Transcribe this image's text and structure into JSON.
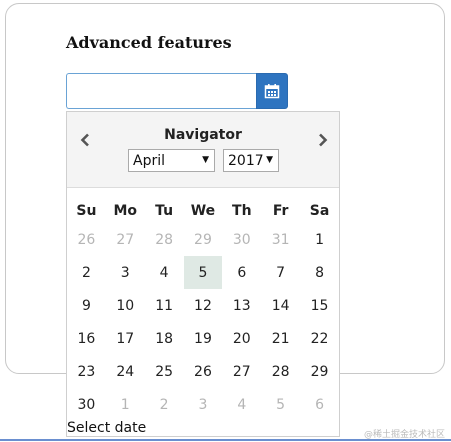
{
  "page": {
    "heading": "Advanced features"
  },
  "date_input": {
    "value": ""
  },
  "navigator": {
    "title": "Navigator",
    "month": "April",
    "year": "2017"
  },
  "calendar": {
    "weekdays": [
      "Su",
      "Mo",
      "Tu",
      "We",
      "Th",
      "Fr",
      "Sa"
    ],
    "weeks": [
      [
        {
          "d": "26",
          "m": true
        },
        {
          "d": "27",
          "m": true
        },
        {
          "d": "28",
          "m": true
        },
        {
          "d": "29",
          "m": true
        },
        {
          "d": "30",
          "m": true
        },
        {
          "d": "31",
          "m": true
        },
        {
          "d": "1"
        }
      ],
      [
        {
          "d": "2"
        },
        {
          "d": "3"
        },
        {
          "d": "4"
        },
        {
          "d": "5",
          "today": true
        },
        {
          "d": "6"
        },
        {
          "d": "7"
        },
        {
          "d": "8"
        }
      ],
      [
        {
          "d": "9"
        },
        {
          "d": "10"
        },
        {
          "d": "11"
        },
        {
          "d": "12"
        },
        {
          "d": "13"
        },
        {
          "d": "14"
        },
        {
          "d": "15"
        }
      ],
      [
        {
          "d": "16"
        },
        {
          "d": "17"
        },
        {
          "d": "18"
        },
        {
          "d": "19"
        },
        {
          "d": "20"
        },
        {
          "d": "21"
        },
        {
          "d": "22"
        }
      ],
      [
        {
          "d": "23"
        },
        {
          "d": "24"
        },
        {
          "d": "25"
        },
        {
          "d": "26"
        },
        {
          "d": "27"
        },
        {
          "d": "28"
        },
        {
          "d": "29"
        }
      ],
      [
        {
          "d": "30"
        },
        {
          "d": "1",
          "m": true
        },
        {
          "d": "2",
          "m": true
        },
        {
          "d": "3",
          "m": true
        },
        {
          "d": "4",
          "m": true
        },
        {
          "d": "5",
          "m": true
        },
        {
          "d": "6",
          "m": true
        }
      ]
    ]
  },
  "footer": {
    "label": "Select date"
  },
  "watermark": {
    "text": "@稀土掘金技术社区"
  },
  "icons": {
    "calendar": "calendar-icon",
    "prev": "chevron-left-icon",
    "next": "chevron-right-icon",
    "dropdown": "caret-down-icon"
  },
  "colors": {
    "accent": "#2e74c0",
    "today_bg": "#dfe9e4",
    "muted_text": "#b5b5b5",
    "header_bg": "#f4f4f4"
  }
}
